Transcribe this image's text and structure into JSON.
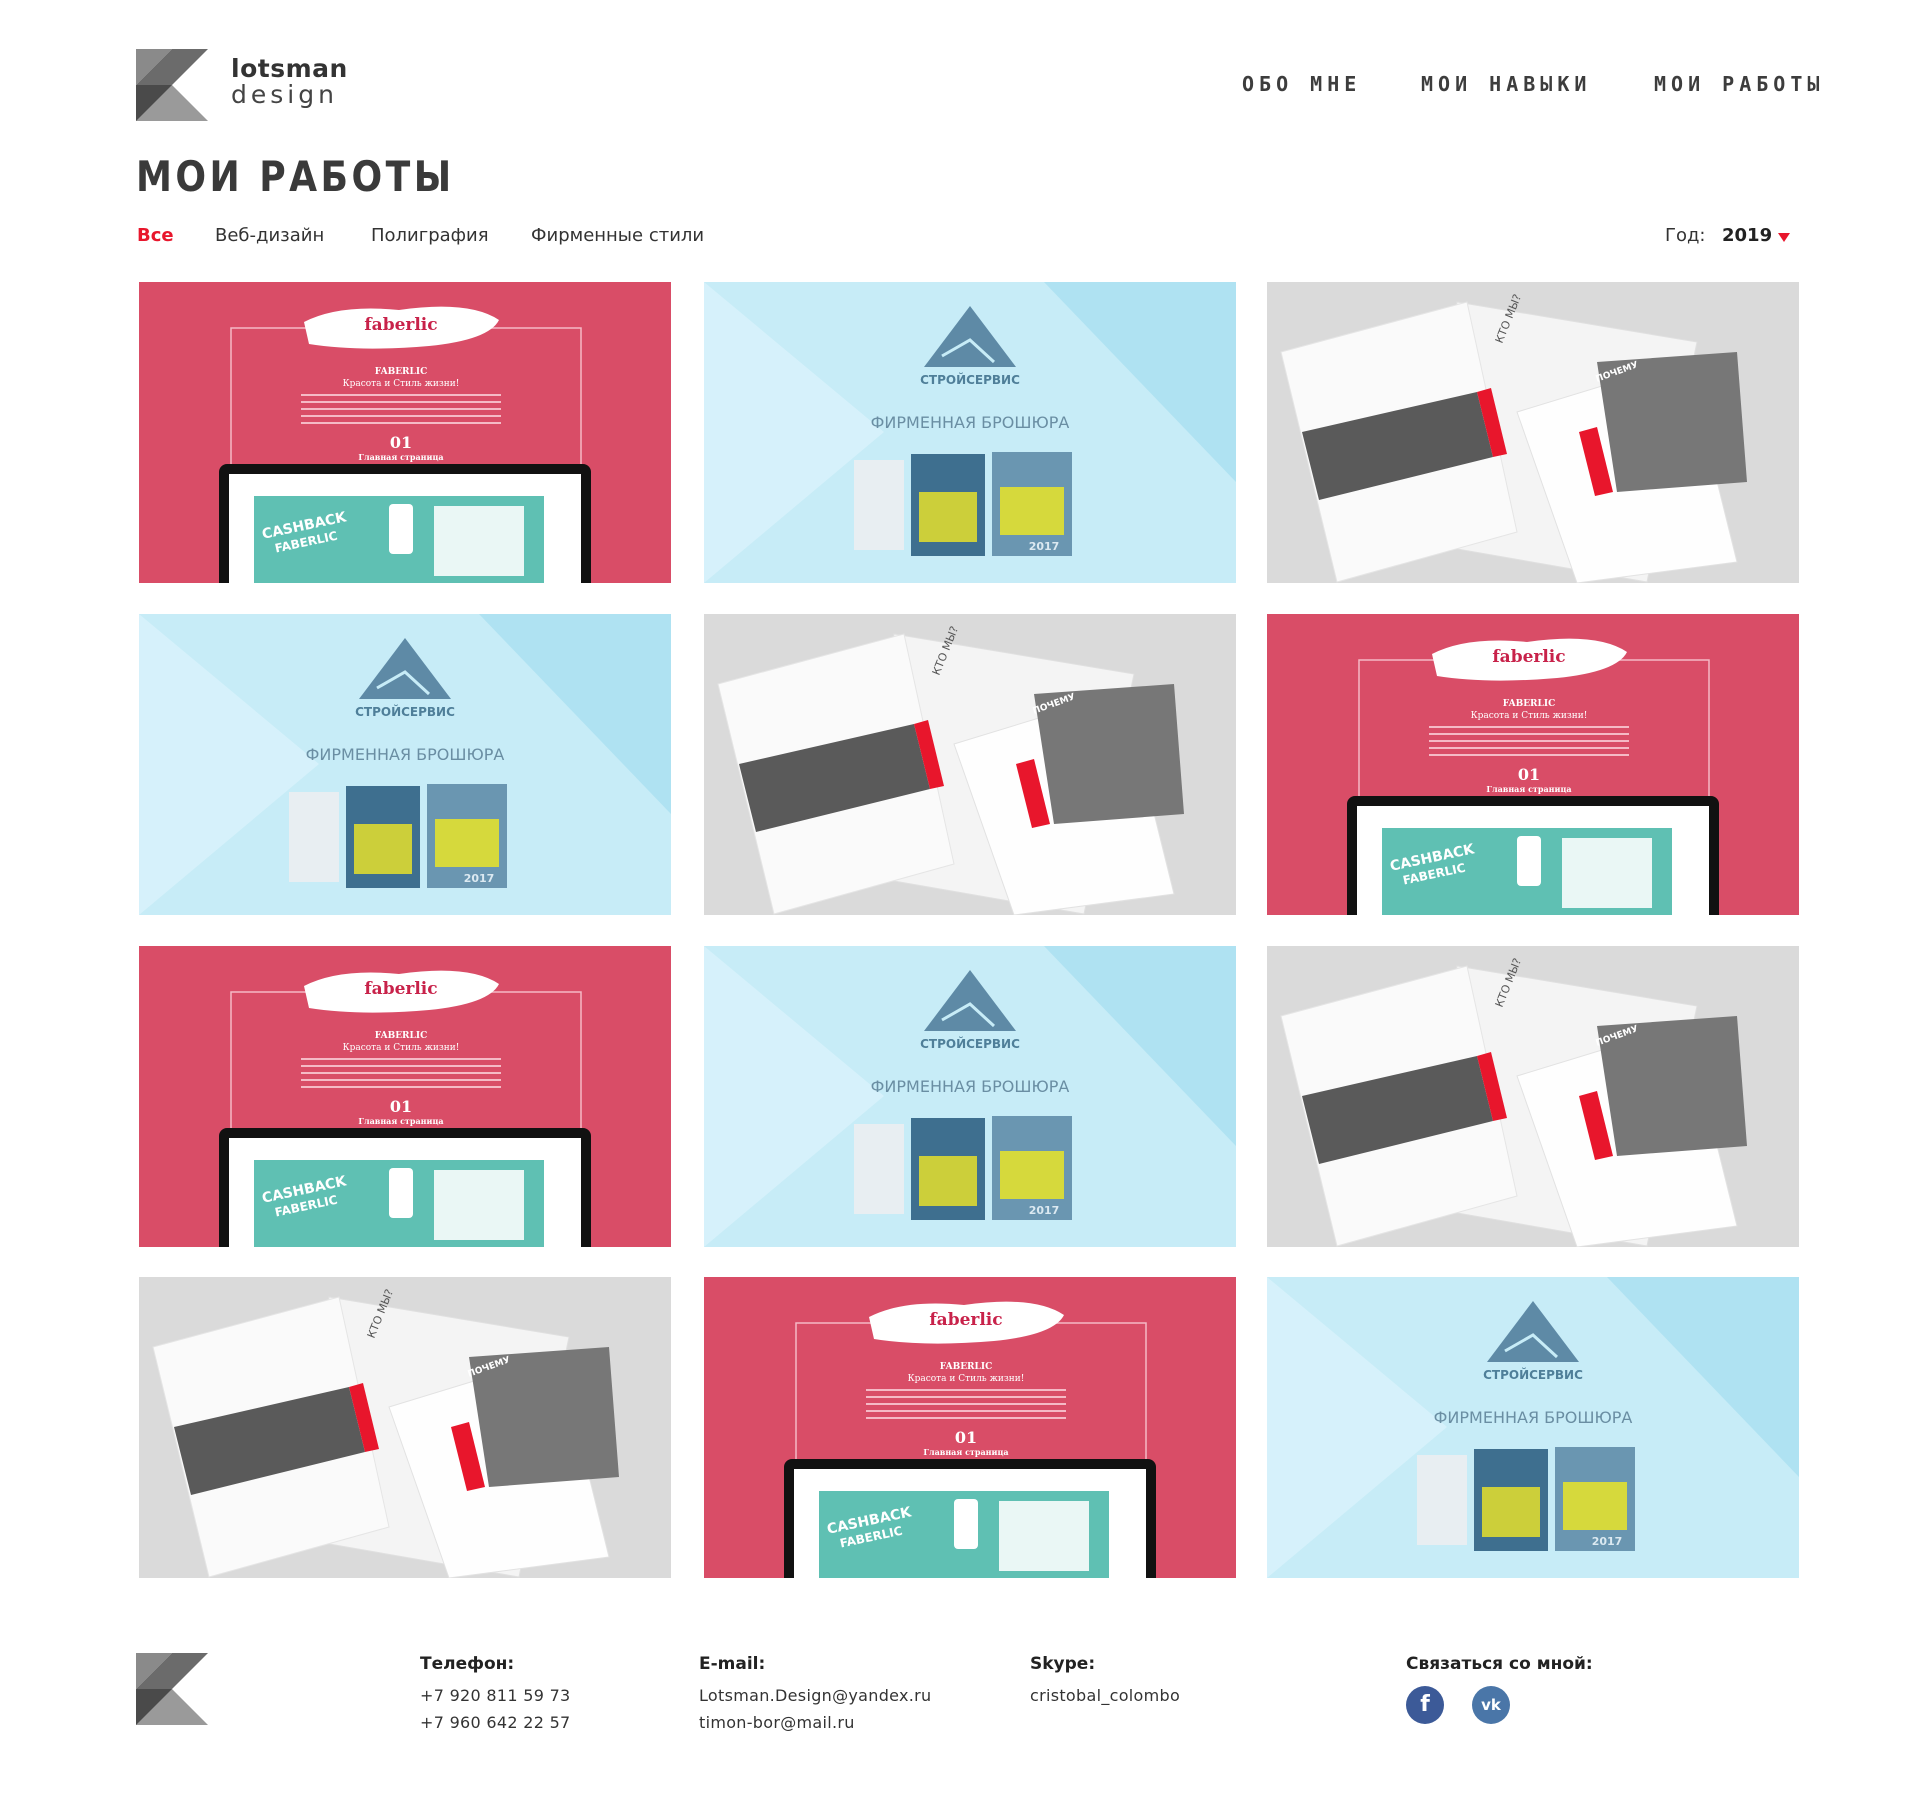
{
  "brand": {
    "name": "lotsman",
    "sub": "design"
  },
  "nav": [
    {
      "label": "ОБО МНЕ"
    },
    {
      "label": "МОИ НАВЫКИ"
    },
    {
      "label": "МОИ РАБОТЫ"
    }
  ],
  "page_title": "МОИ РАБОТЫ",
  "filters": [
    {
      "label": "Все",
      "active": true
    },
    {
      "label": "Веб-дизайн",
      "active": false
    },
    {
      "label": "Полиграфия",
      "active": false
    },
    {
      "label": "Фирменные стили",
      "active": false
    }
  ],
  "year": {
    "label": "Год:",
    "value": "2019"
  },
  "colors": {
    "accent": "#e8162c",
    "faberlic_bg": "#e4566f",
    "stroy_bg": "#c7ecf7",
    "brochure_bg": "#dadada",
    "facebook": "#3c5a98",
    "vk": "#4a76a8"
  },
  "works": [
    {
      "type": "faberlic",
      "logo": "faberlic",
      "heading": "FABERLIC",
      "tagline": "Красота и Стиль жизни!",
      "num": "01",
      "caption": "Главная страница",
      "promo_1": "CASHBACK",
      "promo_2": "FABERLIC"
    },
    {
      "type": "stroy",
      "brand": "СТРОЙСЕРВИС",
      "caption": "ФИРМЕННАЯ БРОШЮРА",
      "year": "2017"
    },
    {
      "type": "brochure",
      "q": "КТО МЫ?",
      "p": "ПОЧЕМУ"
    },
    {
      "type": "stroy",
      "brand": "СТРОЙСЕРВИС",
      "caption": "ФИРМЕННАЯ БРОШЮРА",
      "year": "2017"
    },
    {
      "type": "brochure",
      "q": "КТО МЫ?",
      "p": "ПОЧЕМУ"
    },
    {
      "type": "faberlic",
      "logo": "faberlic",
      "heading": "FABERLIC",
      "tagline": "Красота и Стиль жизни!",
      "num": "01",
      "caption": "Главная страница",
      "promo_1": "CASHBACK",
      "promo_2": "FABERLIC"
    },
    {
      "type": "faberlic",
      "logo": "faberlic",
      "heading": "FABERLIC",
      "tagline": "Красота и Стиль жизни!",
      "num": "01",
      "caption": "Главная страница",
      "promo_1": "CASHBACK",
      "promo_2": "FABERLIC"
    },
    {
      "type": "stroy",
      "brand": "СТРОЙСЕРВИС",
      "caption": "ФИРМЕННАЯ БРОШЮРА",
      "year": "2017"
    },
    {
      "type": "brochure",
      "q": "КТО МЫ?",
      "p": "ПОЧЕМУ"
    },
    {
      "type": "brochure",
      "q": "КТО МЫ?",
      "p": "ПОЧЕМУ"
    },
    {
      "type": "faberlic",
      "logo": "faberlic",
      "heading": "FABERLIC",
      "tagline": "Красота и Стиль жизни!",
      "num": "01",
      "caption": "Главная страница",
      "promo_1": "CASHBACK",
      "promo_2": "FABERLIC"
    },
    {
      "type": "stroy",
      "brand": "СТРОЙСЕРВИС",
      "caption": "ФИРМЕННАЯ БРОШЮРА",
      "year": "2017"
    }
  ],
  "footer": {
    "phone": {
      "label": "Телефон:",
      "values": [
        "+7 920 811 59 73",
        "+7 960 642 22 57"
      ]
    },
    "email": {
      "label": "E-mail:",
      "values": [
        "Lotsman.Design@yandex.ru",
        "timon-bor@mail.ru"
      ]
    },
    "skype": {
      "label": "Skype:",
      "values": [
        "cristobal_colombo"
      ]
    },
    "contact": {
      "label": "Связаться со мной:",
      "icons": [
        "facebook-icon",
        "vk-icon"
      ],
      "facebook_glyph": "f",
      "vk_glyph": "vk"
    }
  }
}
